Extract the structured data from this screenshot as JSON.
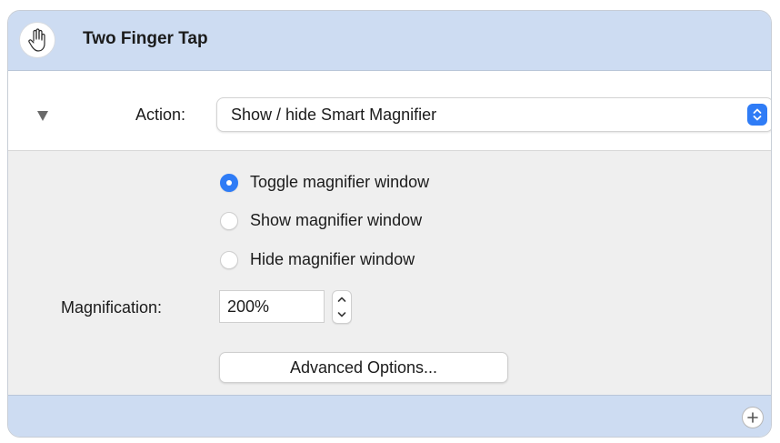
{
  "gesture": {
    "title": "Two Finger Tap",
    "icon": "hand-tap-icon"
  },
  "action": {
    "label": "Action:",
    "selected": "Show / hide Smart Magnifier",
    "accent_color": "#2f7cf6"
  },
  "options": {
    "radios": [
      {
        "label": "Toggle magnifier window",
        "selected": true
      },
      {
        "label": "Show magnifier window",
        "selected": false
      },
      {
        "label": "Hide magnifier window",
        "selected": false
      }
    ],
    "magnification_label": "Magnification:",
    "magnification_value": "200%",
    "advanced_button": "Advanced Options..."
  },
  "colors": {
    "header_bg": "#cddcf2",
    "panel_bg": "#efefef"
  }
}
